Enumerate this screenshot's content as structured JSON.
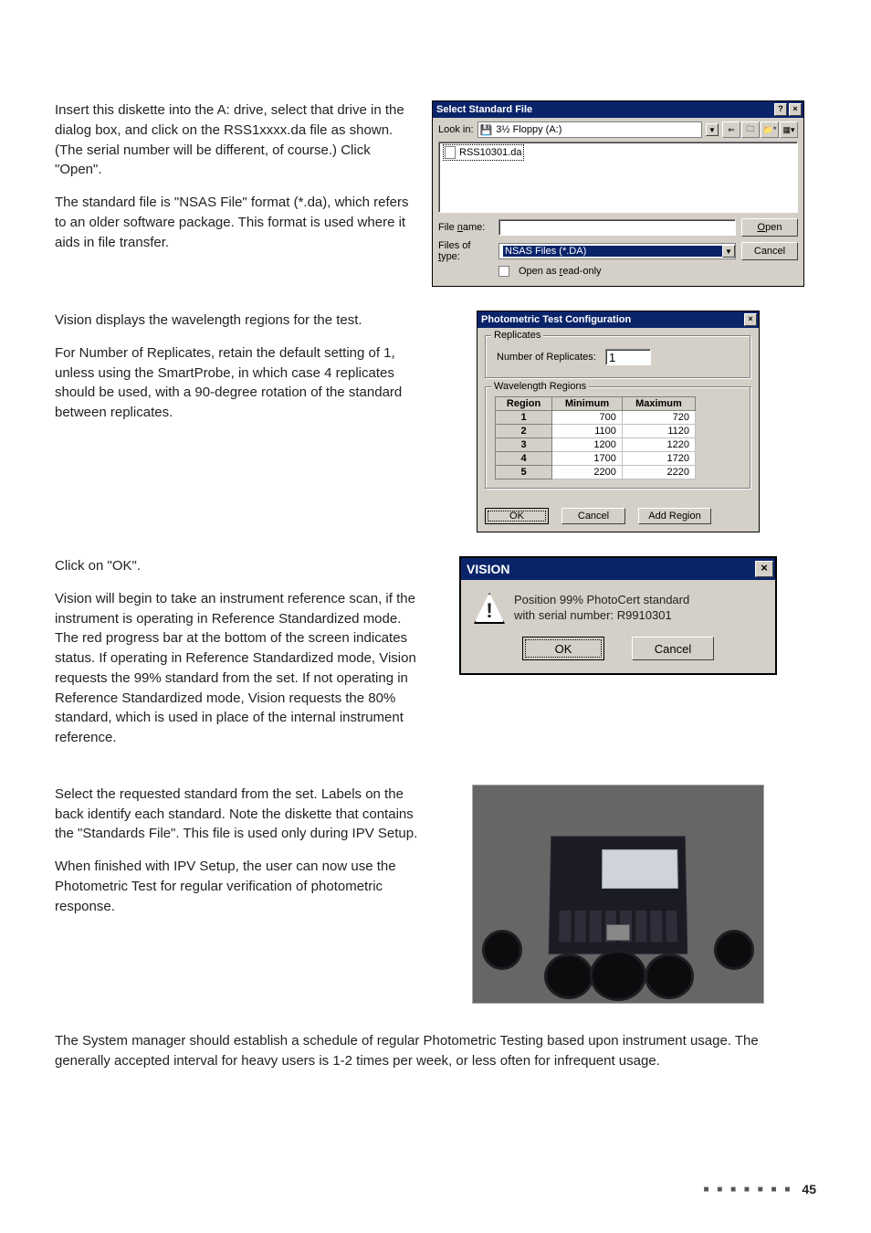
{
  "section1": {
    "p1": "Insert this diskette into the A: drive, select that drive in the dialog box, and click on the RSS1xxxx.da file as shown. (The serial number will be different, of course.) Click \"Open\".",
    "p2": "The standard file is \"NSAS File\" format (*.da), which refers to an older software package. This format is used where it aids in file transfer."
  },
  "dialog_open": {
    "title": "Select Standard File",
    "lookin_label": "Look in:",
    "lookin_value": "3½ Floppy (A:)",
    "file_item": "RSS10301.da",
    "filename_label": "File name:",
    "filename_value": "",
    "filetype_label": "Files of type:",
    "filetype_value": "NSAS Files (*.DA)",
    "readonly_label": "Open as read-only",
    "open_btn": "Open",
    "cancel_btn": "Cancel"
  },
  "section2": {
    "p1": "Vision displays the wavelength regions for the test.",
    "p2": "For Number of Replicates, retain the default setting of 1, unless using the SmartProbe, in which case 4 replicates should be used, with a 90-degree rotation of the standard between replicates."
  },
  "dialog_ptc": {
    "title": "Photometric Test Configuration",
    "grp1": "Replicates",
    "replicates_label": "Number of Replicates:",
    "replicates_value": "1",
    "grp2": "Wavelength Regions",
    "headers": {
      "region": "Region",
      "min": "Minimum",
      "max": "Maximum"
    },
    "rows": [
      {
        "region": "1",
        "min": "700",
        "max": "720"
      },
      {
        "region": "2",
        "min": "1100",
        "max": "1120"
      },
      {
        "region": "3",
        "min": "1200",
        "max": "1220"
      },
      {
        "region": "4",
        "min": "1700",
        "max": "1720"
      },
      {
        "region": "5",
        "min": "2200",
        "max": "2220"
      }
    ],
    "ok_btn": "OK",
    "cancel_btn": "Cancel",
    "add_btn": "Add Region"
  },
  "section3": {
    "p1": "Click on \"OK\".",
    "p2": "Vision will begin to take an instrument reference scan, if the instrument is operating in Reference Standardized mode. The red progress bar at the bottom of the screen indicates status. If operating in Reference Standardized mode, Vision requests the 99% standard from the set. If not operating in Reference Standardized mode, Vision requests the 80% standard, which is used in place of the internal instrument reference."
  },
  "dialog_msg": {
    "title": "VISION",
    "line1": "Position 99% PhotoCert standard",
    "line2": "with serial number: R9910301",
    "ok_btn": "OK",
    "cancel_btn": "Cancel"
  },
  "section4": {
    "p1": "Select the requested standard from the set. Labels on the back identify each standard. Note the diskette that contains the \"Standards File\". This file is used only during IPV Setup.",
    "p2": "When finished with IPV Setup, the user can now use the Photometric Test for regular verification of photometric response."
  },
  "section5": {
    "p1": "The System manager should establish a schedule of regular Photometric Testing based upon instrument usage. The generally accepted interval for heavy users is 1-2 times per week, or less often for infrequent usage."
  },
  "page_number": "45",
  "chart_data": {
    "type": "table",
    "title": "Wavelength Regions",
    "columns": [
      "Region",
      "Minimum",
      "Maximum"
    ],
    "rows": [
      [
        1,
        700,
        720
      ],
      [
        2,
        1100,
        1120
      ],
      [
        3,
        1200,
        1220
      ],
      [
        4,
        1700,
        1720
      ],
      [
        5,
        2200,
        2220
      ]
    ]
  }
}
